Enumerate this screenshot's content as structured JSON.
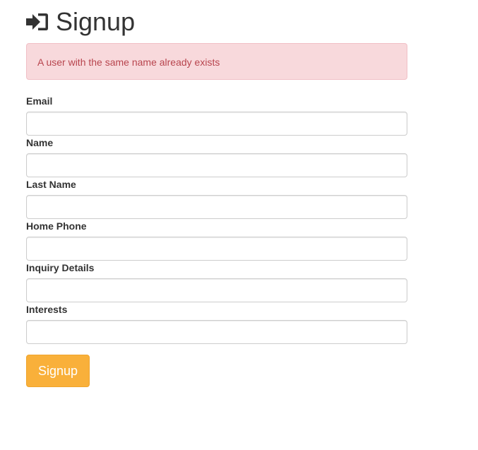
{
  "header": {
    "icon": "sign-in-icon",
    "title": "Signup"
  },
  "alert": {
    "message": "A user with the same name already exists",
    "text_color": "#b8454e",
    "background": "#f8d9dc"
  },
  "form": {
    "fields": [
      {
        "label": "Email",
        "value": "",
        "placeholder": ""
      },
      {
        "label": "Name",
        "value": "",
        "placeholder": ""
      },
      {
        "label": "Last Name",
        "value": "",
        "placeholder": ""
      },
      {
        "label": "Home Phone",
        "value": "",
        "placeholder": ""
      },
      {
        "label": "Inquiry Details",
        "value": "",
        "placeholder": ""
      },
      {
        "label": "Interests",
        "value": "",
        "placeholder": ""
      }
    ],
    "submit_label": "Signup",
    "submit_color": "#f9b03a"
  }
}
